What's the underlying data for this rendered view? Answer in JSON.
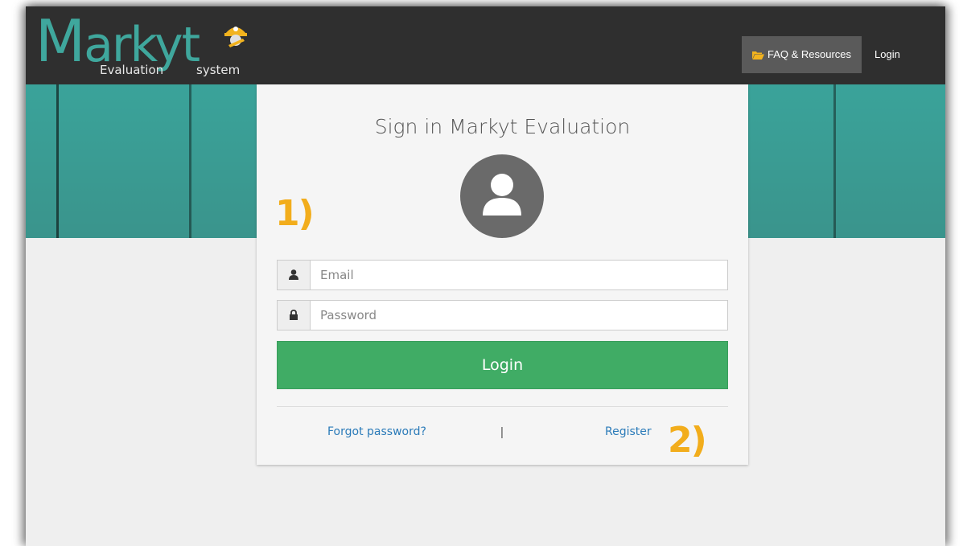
{
  "brand": {
    "logo_main": "arkyt",
    "logo_m": "M",
    "logo_sub1": "Evaluation",
    "logo_sub2": "system",
    "accent": "#3fa79d"
  },
  "navbar": {
    "faq_label": "FAQ & Resources",
    "faq_icon": "folder-open-icon",
    "login_label": "Login"
  },
  "signin": {
    "title": "Sign in Markyt Evaluation",
    "avatar_icon": "user-icon",
    "email_placeholder": "Email",
    "email_icon": "user-icon",
    "password_placeholder": "Password",
    "password_icon": "lock-icon",
    "login_button": "Login",
    "forgot_link": "Forgot password?",
    "separator": "|",
    "register_link": "Register",
    "button_color": "#40ac65",
    "link_color": "#2b7bb9"
  },
  "annotations": {
    "step1": "1)",
    "step2": "2)",
    "color": "#f2ad1c"
  }
}
